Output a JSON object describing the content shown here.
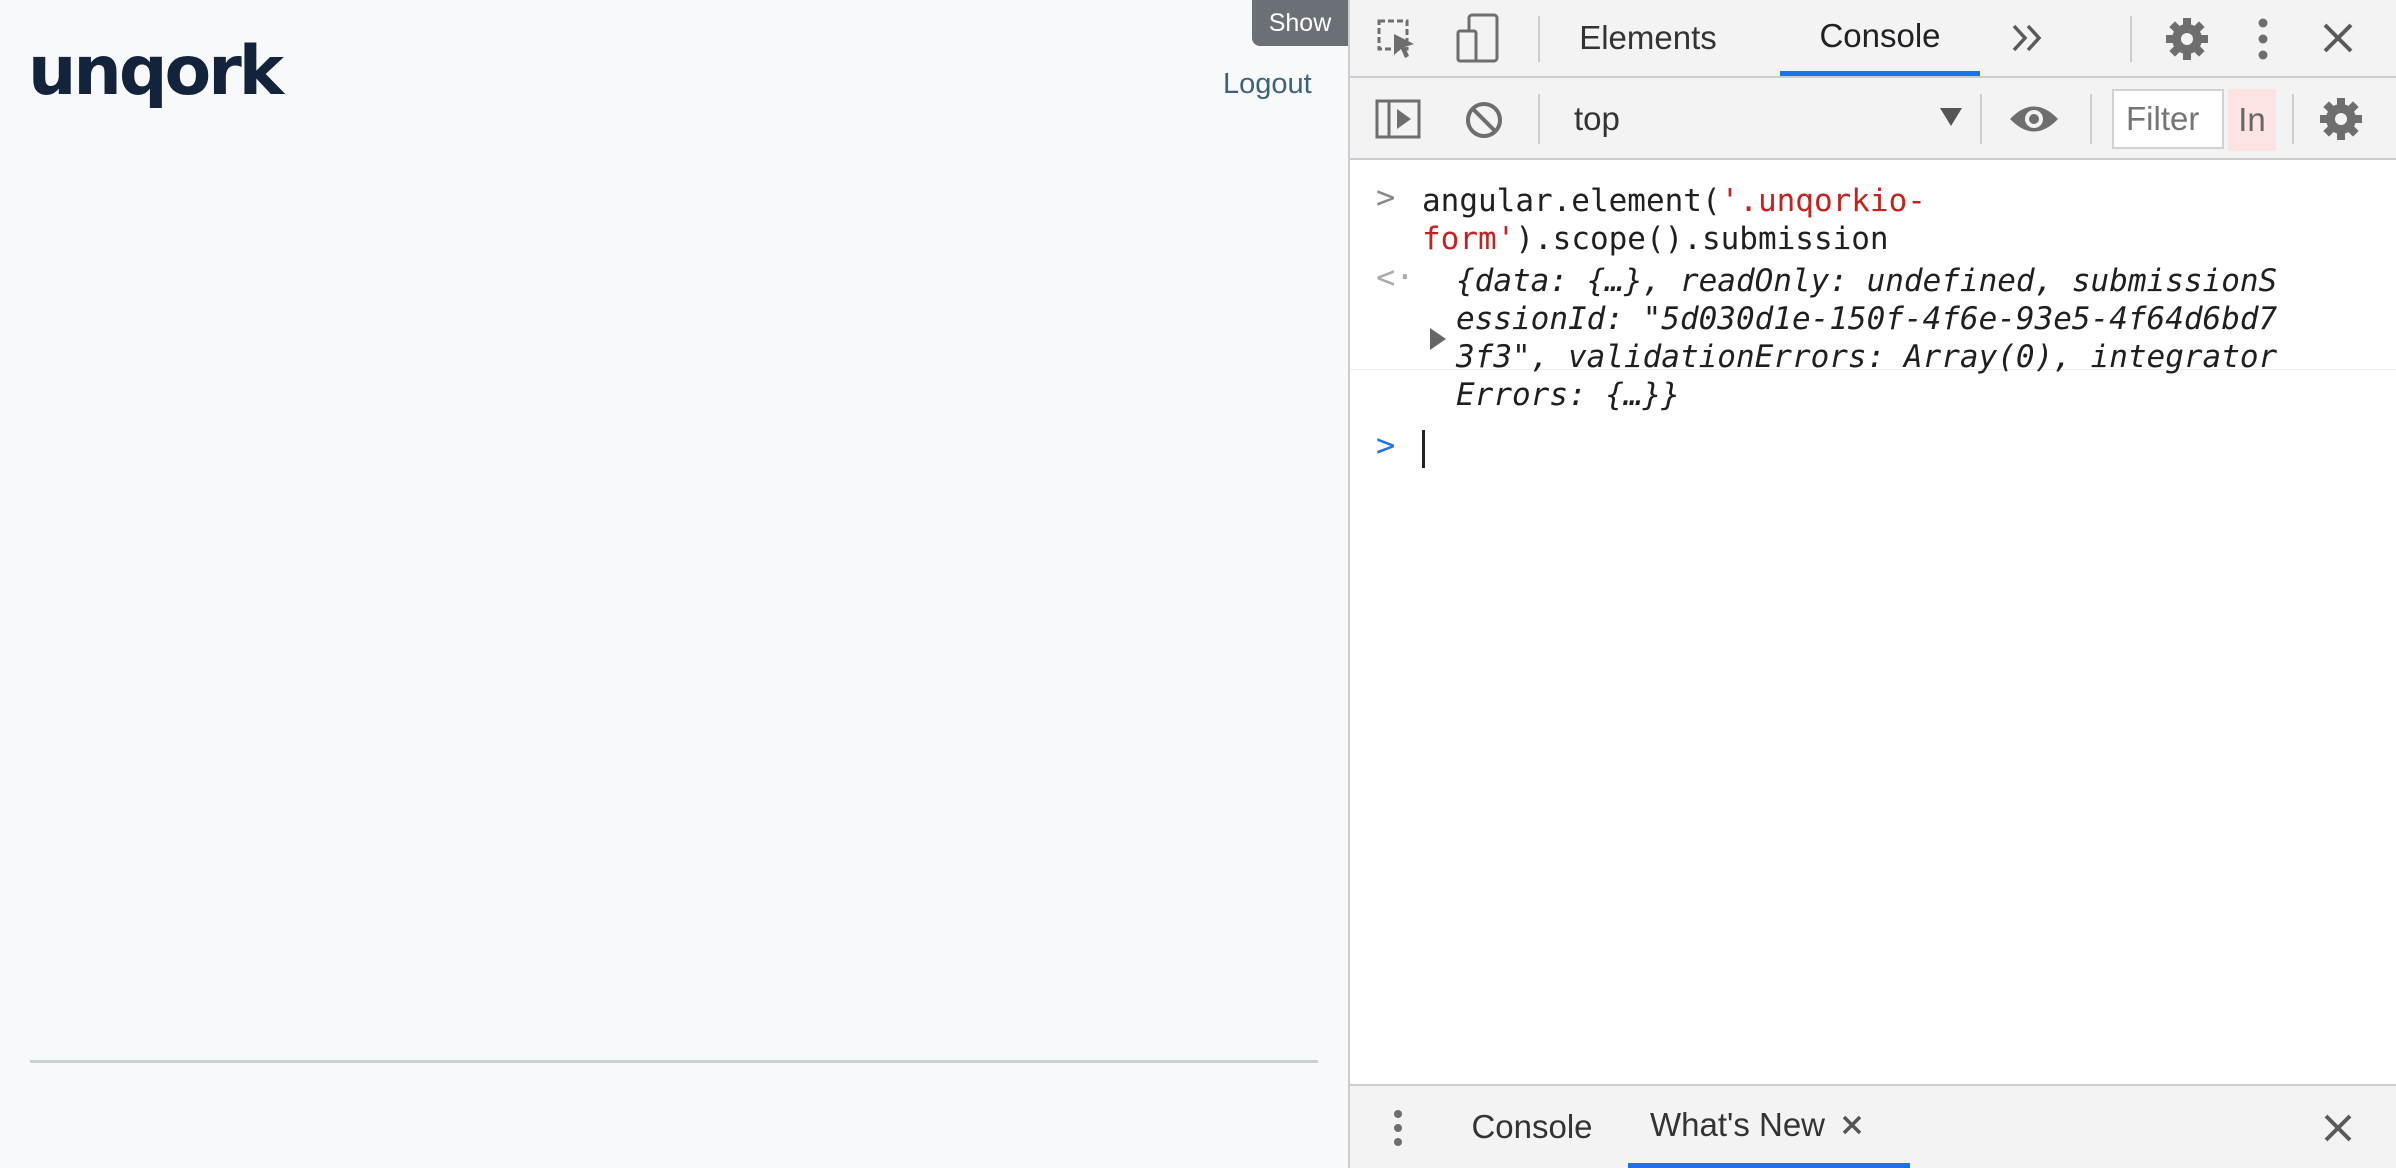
{
  "app": {
    "logo_text": "unqork",
    "show_label": "Show",
    "logout_label": "Logout"
  },
  "devtools": {
    "tabs": [
      {
        "label": "Elements",
        "active": false
      },
      {
        "label": "Console",
        "active": true
      }
    ],
    "more_tabs_icon": "double-chevron-right-icon",
    "toolbar": {
      "context": "top",
      "filter_placeholder": "Filter",
      "levels_label": "In"
    },
    "console": {
      "input_part1": "angular.element(",
      "input_str1": "'.unqorkio-",
      "input_str2": "form'",
      "input_part2": ").scope().submission",
      "result_lines": [
        "{data: {…}, readOnly: undefined, submissionS",
        "essionId: \"5d030d1e-150f-4f6e-93e5-4f64d6bd7",
        "3f3\", validationErrors: Array(0), integrator",
        "Errors: {…}}"
      ]
    },
    "drawer": {
      "tabs": [
        {
          "label": "Console",
          "active": false
        },
        {
          "label": "What's New",
          "active": true
        }
      ]
    },
    "accent": "#1a73e8",
    "string_color": "#c5221f"
  }
}
